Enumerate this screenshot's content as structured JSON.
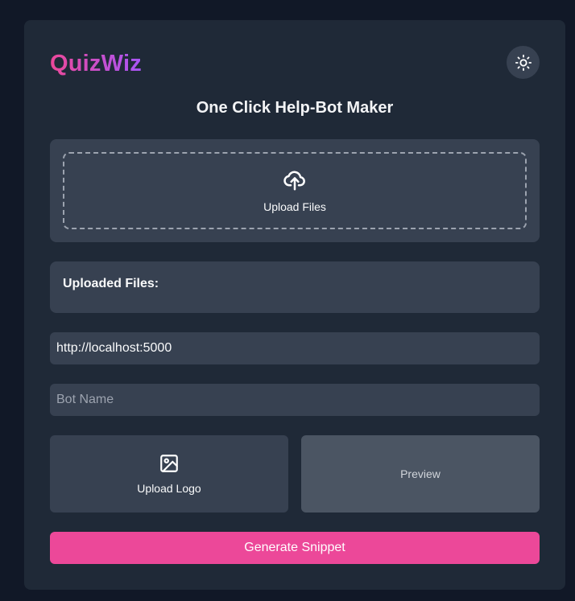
{
  "app": {
    "name": "QuizWiz",
    "subtitle": "One Click Help-Bot Maker",
    "theme_toggle_icon": "sun-icon"
  },
  "upload": {
    "icon": "cloud-upload-icon",
    "label": "Upload Files"
  },
  "uploaded_files": {
    "heading": "Uploaded Files:",
    "items": []
  },
  "form": {
    "url_value": "http://localhost:5000",
    "bot_name_value": "",
    "bot_name_placeholder": "Bot Name"
  },
  "logo_upload": {
    "icon": "image-icon",
    "label": "Upload Logo"
  },
  "preview": {
    "label": "Preview"
  },
  "actions": {
    "generate_label": "Generate Snippet"
  },
  "colors": {
    "page_bg": "#111827",
    "card_bg": "#1f2937",
    "panel_bg": "#374151",
    "preview_bg": "#4b5563",
    "accent_pink": "#ec4899",
    "accent_purple": "#a855f7"
  }
}
